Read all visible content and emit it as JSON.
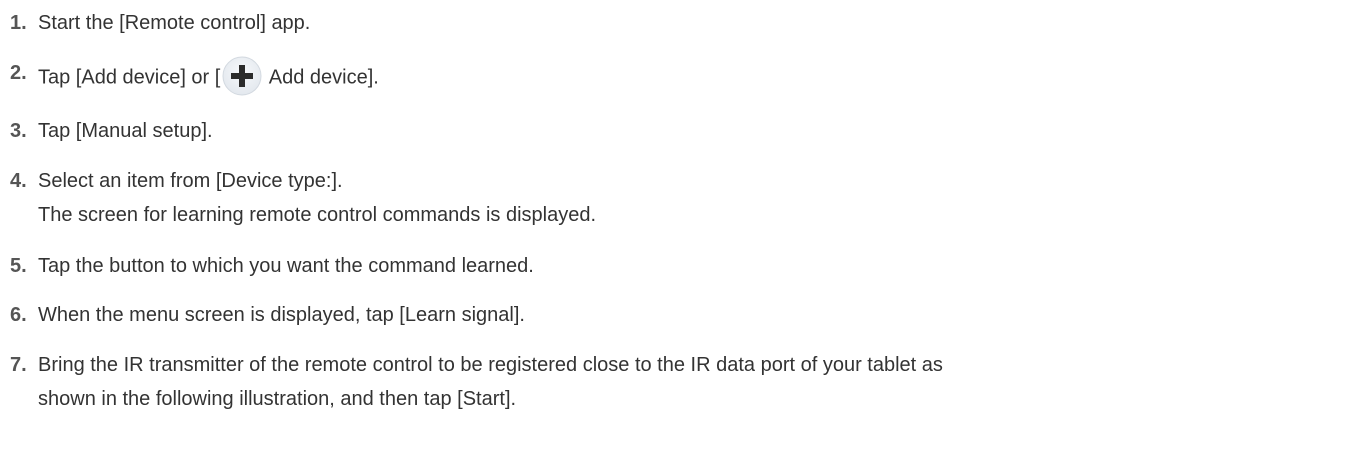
{
  "steps": [
    {
      "number": "1.",
      "text": "Start the [Remote control] app."
    },
    {
      "number": "2.",
      "text_before": "Tap [Add device] or [",
      "icon": "plus-icon",
      "text_after": " Add device]."
    },
    {
      "number": "3.",
      "text": "Tap [Manual setup]."
    },
    {
      "number": "4.",
      "text": "Select an item from [Device type:].",
      "text2": "The screen for learning remote control commands is displayed."
    },
    {
      "number": "5.",
      "text": "Tap the button to which you want the command learned."
    },
    {
      "number": "6.",
      "text": "When the menu screen is displayed, tap [Learn signal]."
    },
    {
      "number": "7.",
      "text": "Bring the IR transmitter of the remote control to be registered close to the IR data port of your tablet as",
      "text2": "shown in the following illustration, and then tap [Start]."
    }
  ],
  "colors": {
    "text": "#333333",
    "number": "#555555",
    "icon_circle": "#eef1f5",
    "icon_border": "#d3d9e0",
    "icon_plus": "#2b2b2b"
  }
}
